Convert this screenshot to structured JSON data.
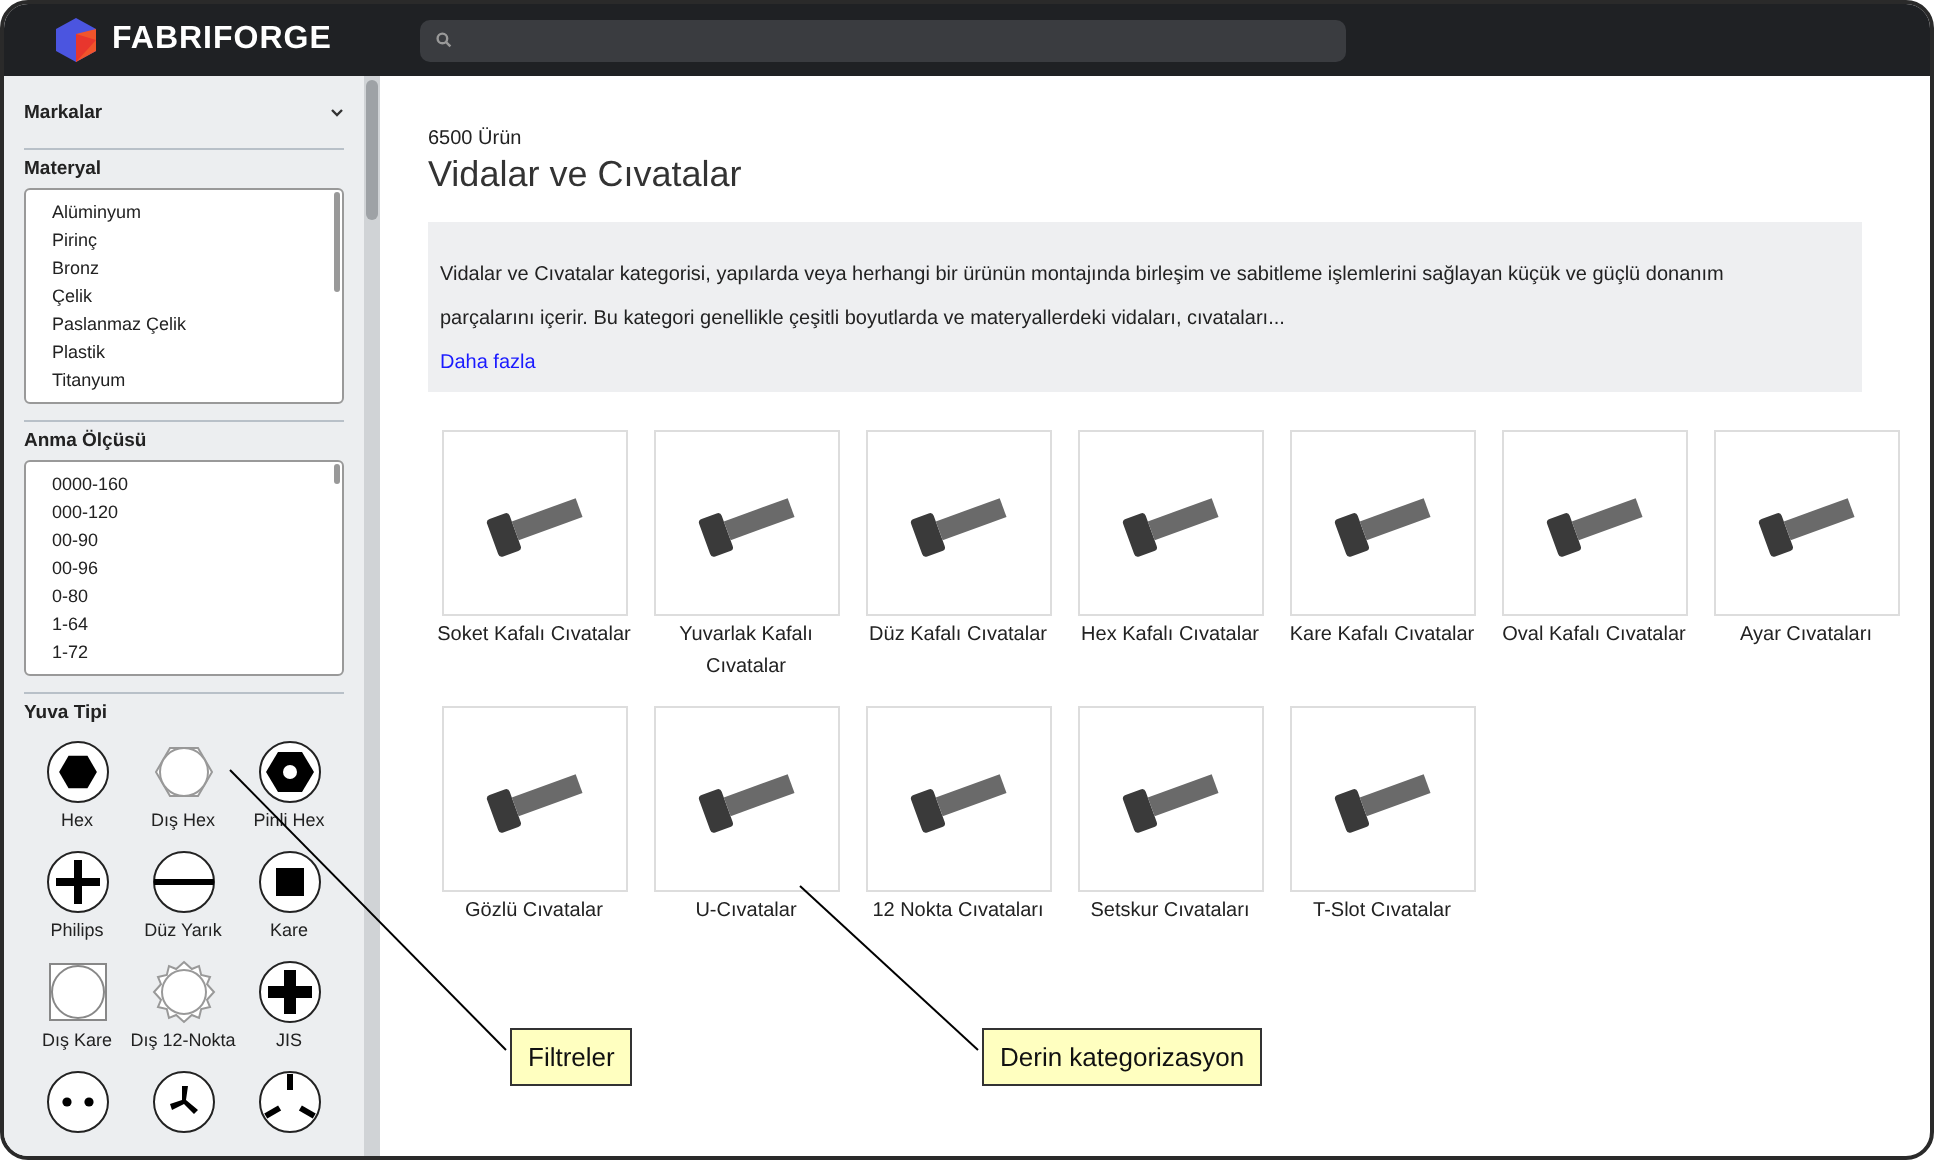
{
  "header": {
    "logo": "FABRIFORGE"
  },
  "sidebar": {
    "brands": {
      "title": "Markalar",
      "expanded": false
    },
    "material": {
      "title": "Materyal",
      "options": [
        "Alüminyum",
        "Pirinç",
        "Bronz",
        "Çelik",
        "Paslanmaz Çelik",
        "Plastik",
        "Titanyum"
      ]
    },
    "size": {
      "title": "Anma Ölçüsü",
      "options": [
        "0000-160",
        "000-120",
        "00-90",
        "00-96",
        "0-80",
        "1-64",
        "1-72"
      ]
    },
    "socket": {
      "title": "Yuva Tipi",
      "types": [
        {
          "kind": "hex",
          "label": "Hex"
        },
        {
          "kind": "outer-hex",
          "label": "Dış Hex"
        },
        {
          "kind": "pin-hex",
          "label": "Pinli Hex"
        },
        {
          "kind": "philips",
          "label": "Philips"
        },
        {
          "kind": "slot",
          "label": "Düz Yarık"
        },
        {
          "kind": "square",
          "label": "Kare"
        },
        {
          "kind": "outer-square",
          "label": "Dış Kare"
        },
        {
          "kind": "outer-12pt",
          "label": "Dış 12-Nokta"
        },
        {
          "kind": "jis",
          "label": "JIS"
        },
        {
          "kind": "two-hole"
        },
        {
          "kind": "tri-wing"
        },
        {
          "kind": "tri-groove"
        }
      ]
    }
  },
  "main": {
    "count": "6500 Ürün",
    "title": "Vidalar ve Cıvatalar",
    "description": "Vidalar ve Cıvatalar kategorisi, yapılarda veya herhangi bir ürünün montajında birleşim ve sabitleme işlemlerini sağlayan küçük ve güçlü donanım parçalarını içerir. Bu kategori genellikle çeşitli boyutlarda ve materyallerdeki vidaları, cıvataları...",
    "more_link": "Daha fazla",
    "categories": [
      {
        "label": "Soket Kafalı Cıvatalar"
      },
      {
        "label": "Yuvarlak Kafalı Cıvatalar"
      },
      {
        "label": "Düz Kafalı Cıvatalar"
      },
      {
        "label": "Hex Kafalı Cıvatalar"
      },
      {
        "label": "Kare Kafalı Cıvatalar"
      },
      {
        "label": "Oval Kafalı Cıvatalar"
      },
      {
        "label": "Ayar Cıvataları"
      },
      {
        "label": "Gözlü Cıvatalar"
      },
      {
        "label": "U-Cıvatalar"
      },
      {
        "label": "12 Nokta Cıvataları"
      },
      {
        "label": "Setskur Cıvataları"
      },
      {
        "label": "T-Slot Cıvatalar"
      }
    ]
  },
  "annotations": [
    {
      "label": "Filtreler"
    },
    {
      "label": "Derin kategorizasyon"
    }
  ]
}
